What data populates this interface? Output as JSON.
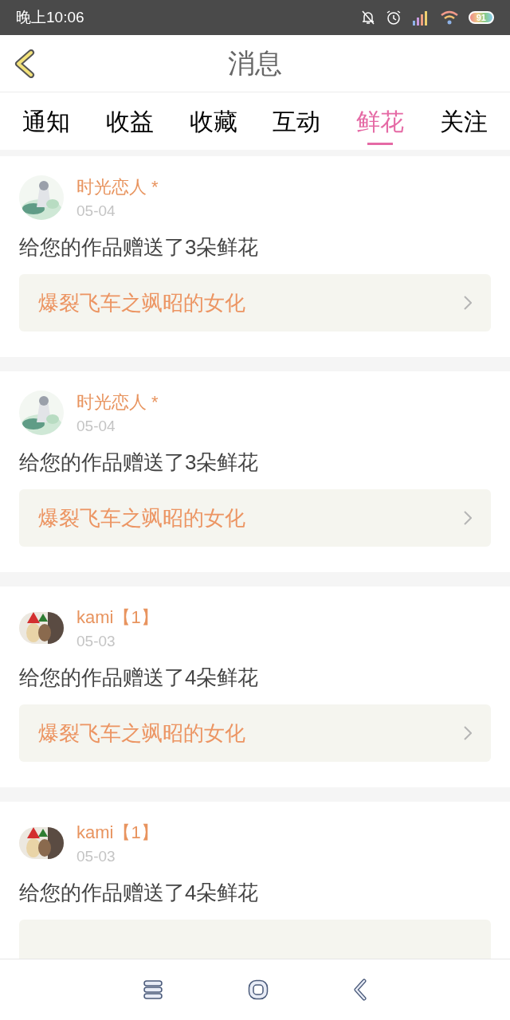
{
  "status_bar": {
    "time": "晚上10:06",
    "battery": "91"
  },
  "header": {
    "title": "消息"
  },
  "tabs": [
    {
      "label": "通知",
      "selected": false
    },
    {
      "label": "收益",
      "selected": false
    },
    {
      "label": "收藏",
      "selected": false
    },
    {
      "label": "互动",
      "selected": false
    },
    {
      "label": "鲜花",
      "selected": true
    },
    {
      "label": "关注",
      "selected": false
    }
  ],
  "messages": [
    {
      "user": "时光恋人 *",
      "date": "05-04",
      "text": "给您的作品赠送了3朵鲜花",
      "work": "爆裂飞车之飒昭的女化"
    },
    {
      "user": "时光恋人 *",
      "date": "05-04",
      "text": "给您的作品赠送了3朵鲜花",
      "work": "爆裂飞车之飒昭的女化"
    },
    {
      "user": "kami【1】",
      "date": "05-03",
      "text": "给您的作品赠送了4朵鲜花",
      "work": "爆裂飞车之飒昭的女化"
    },
    {
      "user": "kami【1】",
      "date": "05-03",
      "text": "给您的作品赠送了4朵鲜花"
    }
  ]
}
